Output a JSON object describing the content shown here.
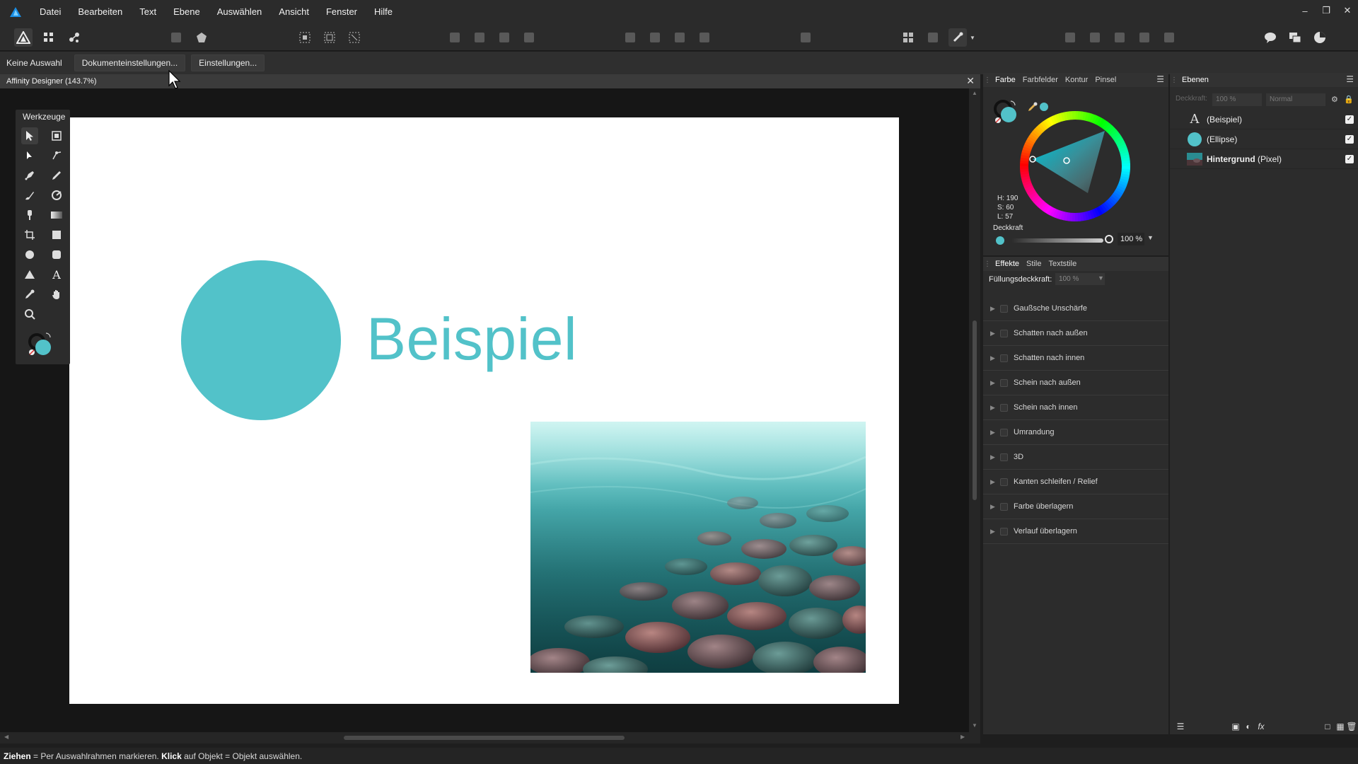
{
  "app": {
    "document_title": "Affinity Designer (143.7%)"
  },
  "menu": [
    "Datei",
    "Bearbeiten",
    "Text",
    "Ebene",
    "Auswählen",
    "Ansicht",
    "Fenster",
    "Hilfe"
  ],
  "context_bar": {
    "selection": "Keine Auswahl",
    "doc_settings": "Dokumenteinstellungen...",
    "settings": "Einstellungen..."
  },
  "tools_panel": {
    "title": "Werkzeuge",
    "tools": [
      "move-tool",
      "artboard-tool",
      "node-tool",
      "point-transform-tool",
      "pen-tool",
      "pencil-tool",
      "vector-brush-tool",
      "fill-tool",
      "fill-brush-tool",
      "transparency-tool",
      "crop-tool",
      "rectangle-tool",
      "ellipse-tool",
      "rounded-rectangle-tool",
      "triangle-tool",
      "artistic-text-tool",
      "color-picker-tool",
      "hand-tool",
      "zoom-tool"
    ]
  },
  "canvas": {
    "heading": "Beispiel",
    "accent_color": "#52c2c9",
    "photo": "turquoise pebble beach"
  },
  "color_panel": {
    "tabs": [
      "Farbe",
      "Farbfelder",
      "Kontur",
      "Pinsel"
    ],
    "active_tab": "Farbe",
    "h": "H: 190",
    "s": "S: 60",
    "l": "L: 57",
    "opacity_label": "Deckkraft",
    "opacity_value": "100 %",
    "opacity_fraction": 1.0
  },
  "effects_panel": {
    "tabs": [
      "Effekte",
      "Stile",
      "Textstile"
    ],
    "active_tab": "Effekte",
    "fill_label": "Füllungsdeckkraft:",
    "fill_value": "100 %",
    "effects": [
      "Gaußsche Unschärfe",
      "Schatten nach außen",
      "Schatten nach innen",
      "Schein nach außen",
      "Schein nach innen",
      "Umrandung",
      "3D",
      "Kanten schleifen / Relief",
      "Farbe überlagern",
      "Verlauf überlagern"
    ]
  },
  "layers_panel": {
    "title": "Ebenen",
    "opacity_label": "Deckkraft:",
    "opacity_value": "100 %",
    "blend_mode": "Normal",
    "layers": [
      {
        "name": "(Beispiel)",
        "bold": "",
        "type": "text",
        "visible": true
      },
      {
        "name": "(Ellipse)",
        "bold": "",
        "type": "ellipse",
        "visible": true
      },
      {
        "name": "(Pixel)",
        "bold": "Hintergrund",
        "type": "pixel",
        "visible": true
      }
    ]
  },
  "status_bar": {
    "bold1": "Ziehen",
    "text1": " = Per Auswahlrahmen markieren. ",
    "bold2": "Klick",
    "text2": " auf Objekt = Objekt auswählen."
  }
}
